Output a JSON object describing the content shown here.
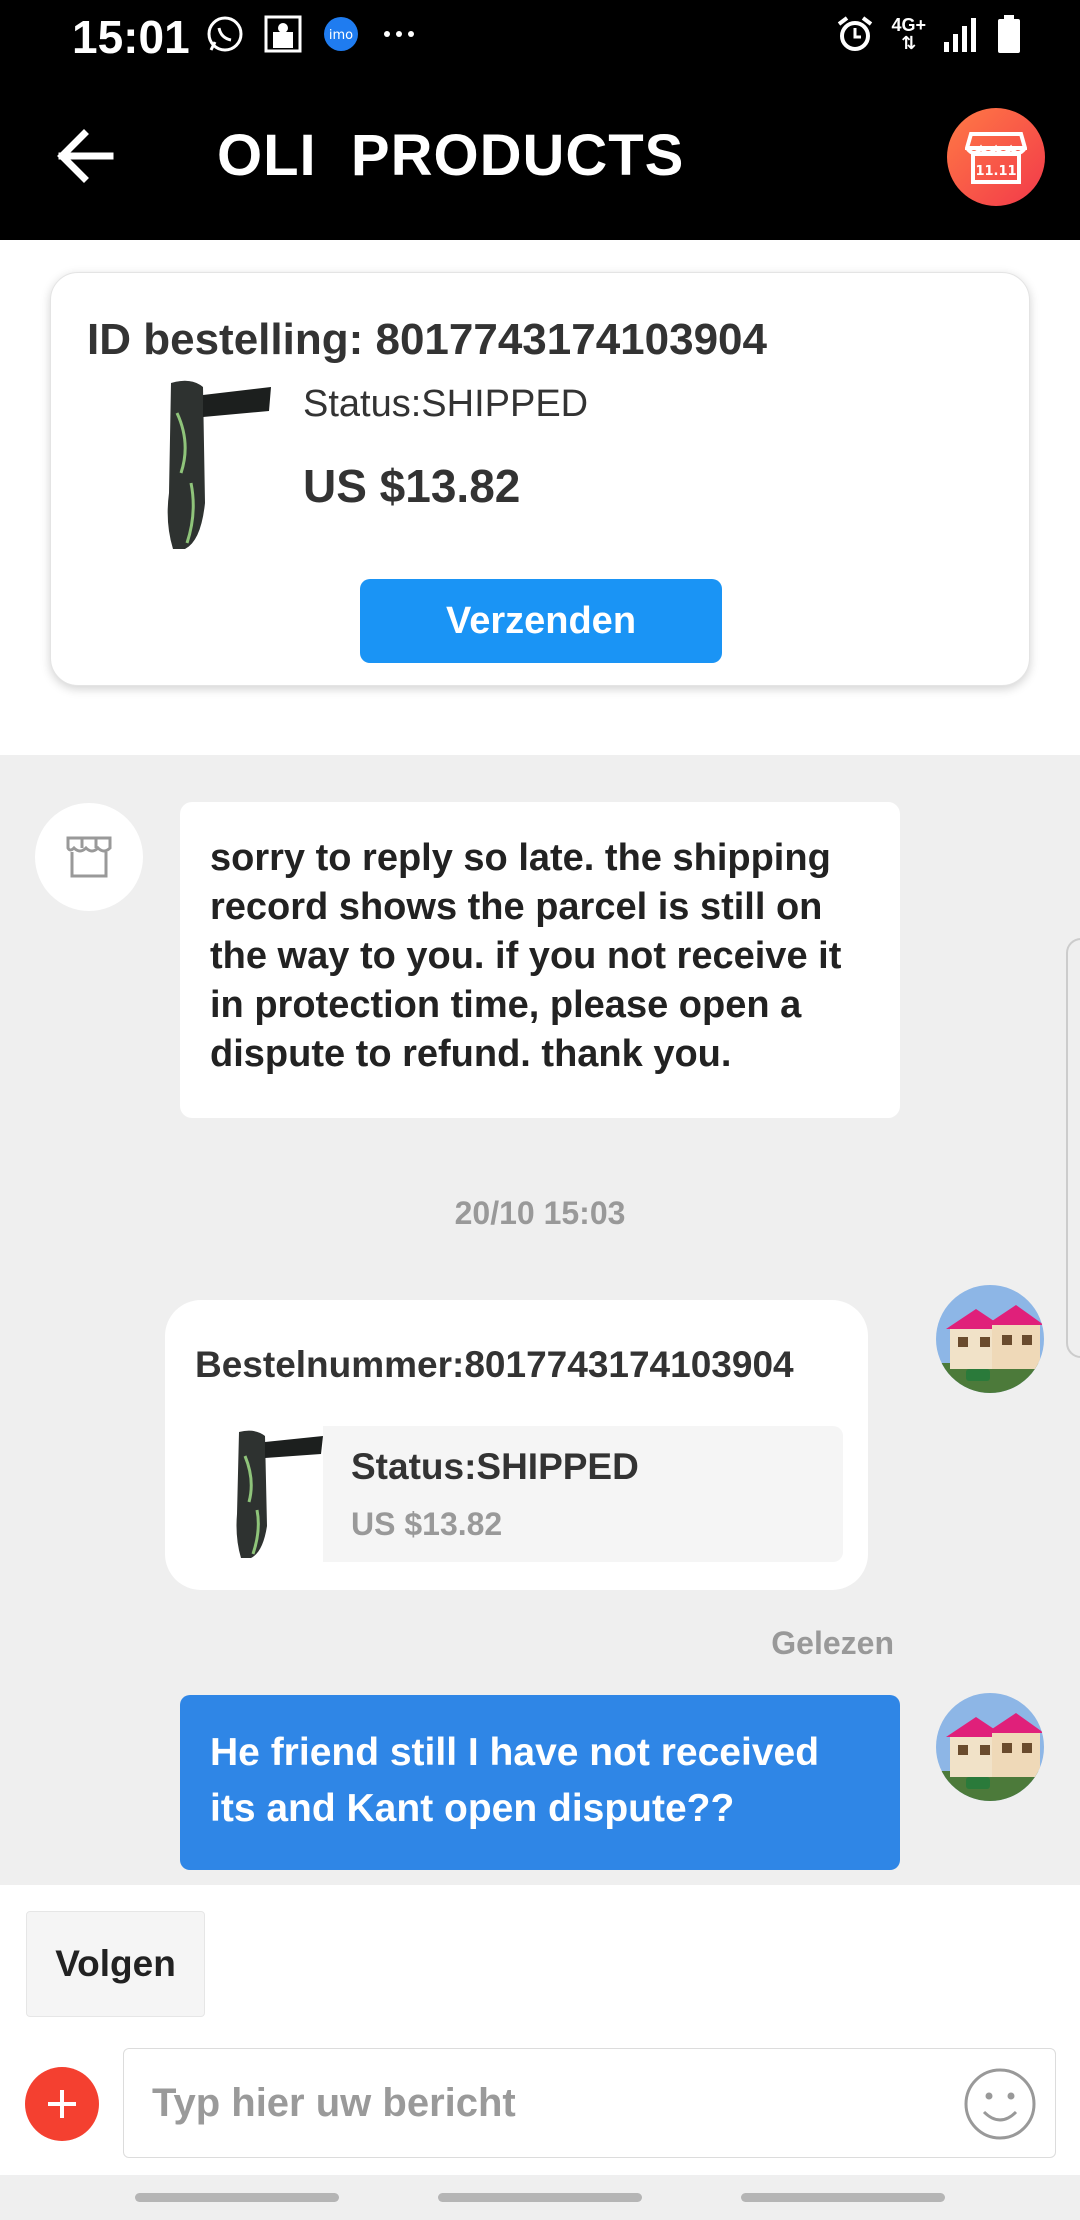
{
  "status_bar": {
    "time": "15:01",
    "network": "4G+"
  },
  "header": {
    "title": "OLI  PRODUCTS"
  },
  "order_card": {
    "order_id": "ID bestelling: 8017743174103904",
    "status": "Status:SHIPPED",
    "price": "US $13.82",
    "send_label": "Verzenden"
  },
  "chat": {
    "incoming_message": "sorry to reply so late. the shipping record shows the parcel is still on the way to you.  if you not receive it in protection time, please open a dispute to refund. thank you.",
    "timestamp": "20/10 15:03",
    "order_message": {
      "number": "Bestelnummer:8017743174103904",
      "status": "Status:SHIPPED",
      "price": "US $13.82"
    },
    "read_label": "Gelezen",
    "outgoing_message": "He friend still I have not received its and Kant open dispute??"
  },
  "composer": {
    "follow_label": "Volgen",
    "placeholder": "Typ hier uw bericht"
  },
  "colors": {
    "accent_blue": "#1a94f5",
    "outgoing_bubble": "#2f86e6",
    "plus_red": "#f44030"
  }
}
